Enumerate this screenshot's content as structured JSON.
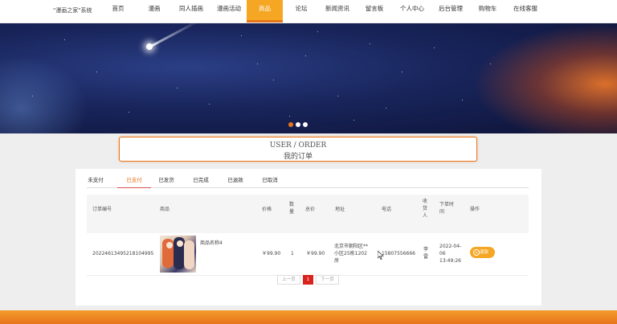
{
  "brand": "\"漫画之家\"系统",
  "nav": [
    "首页",
    "漫画",
    "同人插画",
    "漫画活动",
    "商品",
    "论坛",
    "新闻资讯",
    "留言板",
    "个人中心",
    "后台管理",
    "购物车",
    "在线客服"
  ],
  "nav_active": "商品",
  "banner": {
    "slides": 3,
    "active_slide": 1
  },
  "page_title": {
    "en": "USER / ORDER",
    "cn": "我的订单"
  },
  "tabs": [
    "未支付",
    "已支付",
    "已发货",
    "已完成",
    "已退款",
    "已取消"
  ],
  "active_tab": "已支付",
  "table": {
    "headers": {
      "order_no": "订单编号",
      "product": "商品",
      "price": "价格",
      "qty": "数量",
      "total": "总价",
      "address": "地址",
      "phone": "电话",
      "receiver": "收货人",
      "time": "下单时间",
      "action": "操作"
    },
    "rows": [
      {
        "order_no": "20224613495218104995",
        "product_name": "商品名称4",
        "price": "￥99.90",
        "qty": "1",
        "total": "￥99.90",
        "address": "北京市朝阳区**小区25栋1202房",
        "phone": "15807556666",
        "receiver": "李雷",
        "time": "2022-04-06 13:49:26",
        "action": "退款"
      }
    ]
  },
  "pagination": {
    "prev": "上一页",
    "current": "1",
    "next": "下一页"
  },
  "colors": {
    "accent": "#f5a623",
    "accent_dark": "#e8741a",
    "page_active": "#d9231d"
  }
}
